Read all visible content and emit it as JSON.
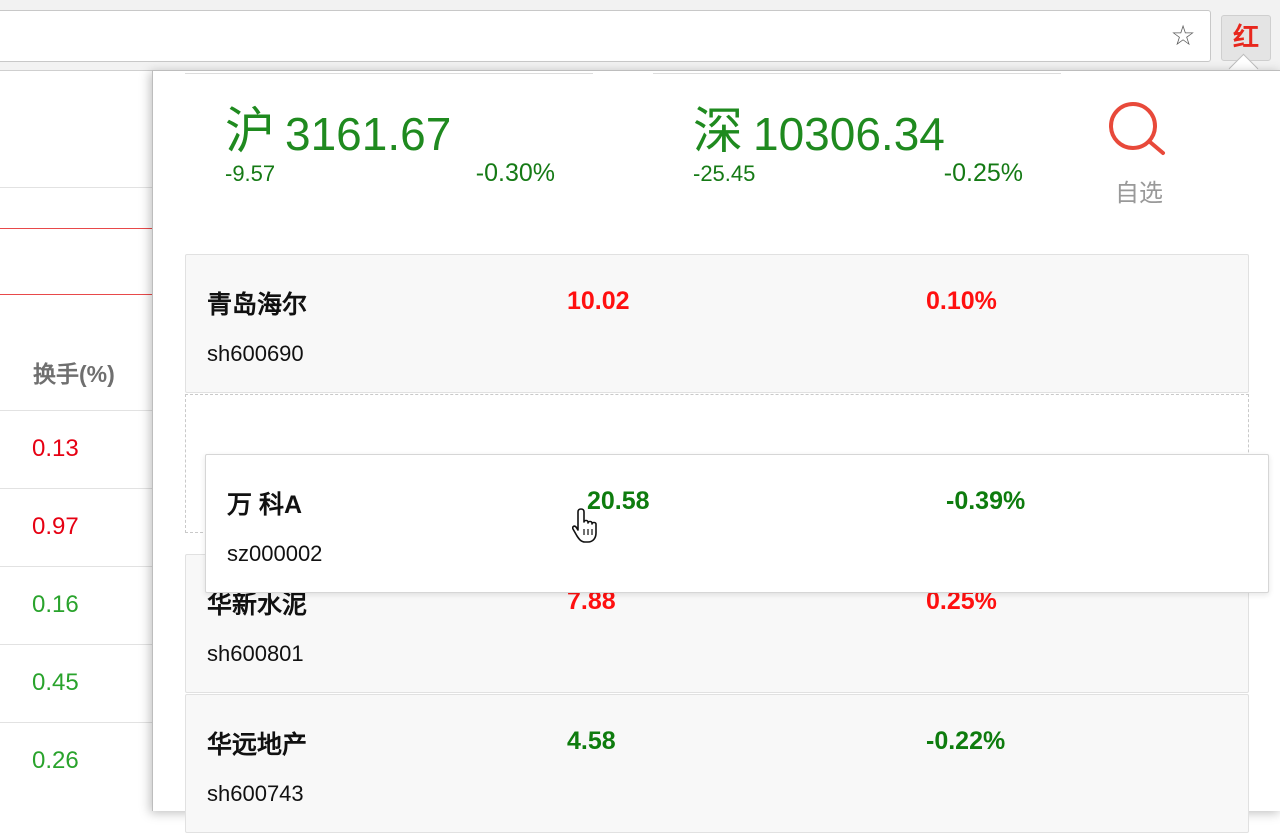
{
  "browser": {
    "star_icon": "star-icon",
    "extension_icon_label": "红"
  },
  "background_table": {
    "header": "换手(%)",
    "rows": [
      {
        "value": "0.13",
        "color": "#e60012"
      },
      {
        "value": "0.97",
        "color": "#e60012"
      },
      {
        "value": "0.16",
        "color": "#29a32c"
      },
      {
        "value": "0.45",
        "color": "#29a32c"
      },
      {
        "value": "0.26",
        "color": "#29a32c"
      }
    ]
  },
  "indices": [
    {
      "name": "沪",
      "value": "3161.67",
      "change": "-9.57",
      "pct": "-0.30%"
    },
    {
      "name": "深",
      "value": "10306.34",
      "change": "-25.45",
      "pct": "-0.25%"
    }
  ],
  "search": {
    "label": "自选",
    "icon": "magnifier-icon"
  },
  "stocks": [
    {
      "name": "青岛海尔",
      "code": "sh600690",
      "price": "10.02",
      "pct": "0.10%",
      "trend": "up"
    },
    {
      "name": "万 科A",
      "code": "sz000002",
      "price": "20.58",
      "pct": "-0.39%",
      "trend": "down",
      "dragging": true
    },
    {
      "name": "华新水泥",
      "code": "sh600801",
      "price": "7.88",
      "pct": "0.25%",
      "trend": "up"
    },
    {
      "name": "华远地产",
      "code": "sh600743",
      "price": "4.58",
      "pct": "-0.22%",
      "trend": "down"
    }
  ],
  "colors": {
    "up": "#ff1010",
    "down": "#0e7c0e",
    "accent": "#e8271d"
  }
}
